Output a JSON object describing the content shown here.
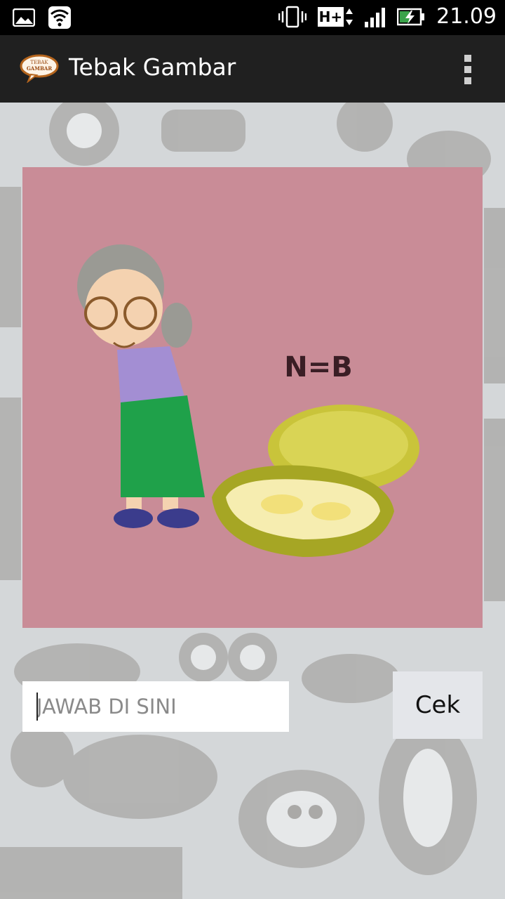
{
  "status_bar": {
    "network_type": "H+",
    "time": "21.09",
    "icons": [
      "image-icon",
      "wifi-icon",
      "vibrate-icon",
      "network-h-plus-icon",
      "signal-icon",
      "battery-charging-icon"
    ]
  },
  "action_bar": {
    "logo_text_top": "TEBAK",
    "logo_text_bottom": "GAMBAR",
    "title": "Tebak Gambar",
    "overflow_icon": "overflow-menu-icon"
  },
  "puzzle": {
    "clue_text": "N=B",
    "depicts": [
      "grandmother",
      "jackfruit"
    ],
    "background_color": "#c98c97"
  },
  "answer": {
    "placeholder": "JAWAB DI SINI",
    "value": ""
  },
  "check_button": {
    "label": "Cek"
  }
}
